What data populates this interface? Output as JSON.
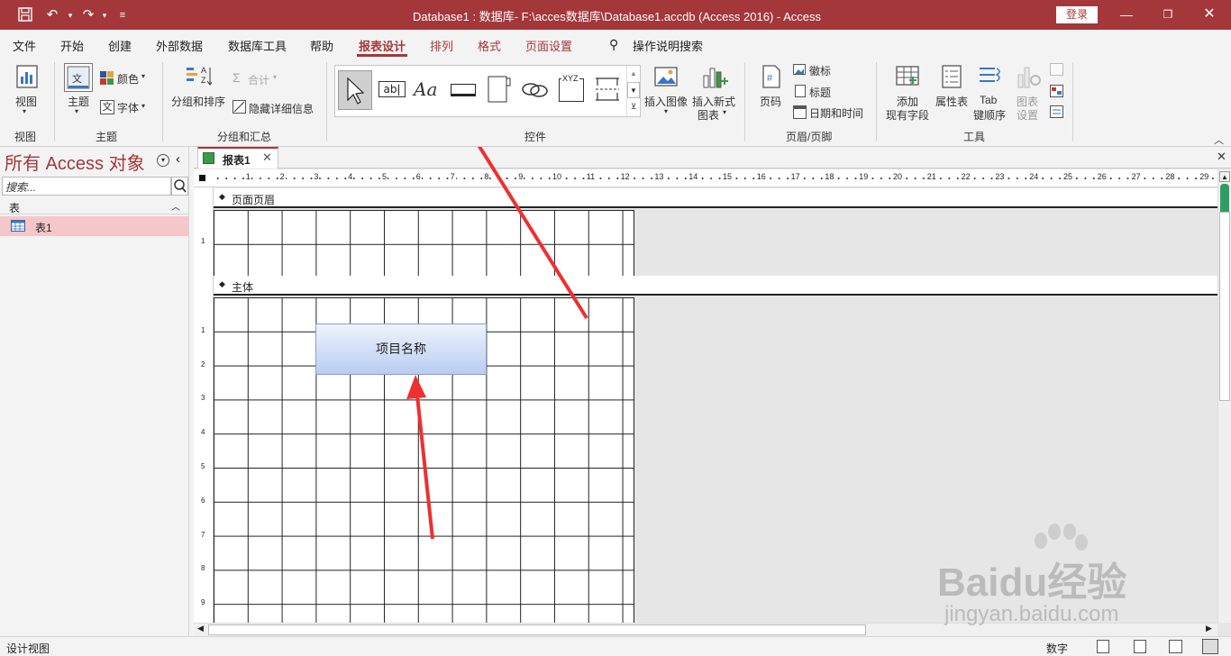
{
  "titlebar": {
    "title": "Database1 : 数据库- F:\\acces数据库\\Database1.accdb (Access 2016)  -  Access",
    "login": "登录",
    "colors": {
      "accent": "#a4373a"
    }
  },
  "menu_tabs": [
    "文件",
    "开始",
    "创建",
    "外部数据",
    "数据库工具",
    "帮助",
    "报表设计",
    "排列",
    "格式",
    "页面设置"
  ],
  "active_tab": "报表设计",
  "tell_me": "操作说明搜索",
  "ribbon": {
    "views": {
      "view": "视图",
      "group": "视图"
    },
    "themes": {
      "theme": "主题",
      "colors": "颜色",
      "fonts": "字体",
      "group": "主题"
    },
    "grouping": {
      "group_sort": "分组和排序",
      "totals": "合计",
      "hide_details": "隐藏详细信息",
      "group": "分组和汇总"
    },
    "controls": {
      "group": "控件",
      "insert_image": "插入图像",
      "insert_chart_1": "插入新式",
      "insert_chart_2": "图表",
      "textbox_glyph": "ab|",
      "label_glyph": "Aa",
      "xyz_glyph": "XYZ"
    },
    "header_footer": {
      "page_numbers": "页码",
      "logo": "徽标",
      "title": "标题",
      "date_time": "日期和时间",
      "group": "页眉/页脚"
    },
    "tools": {
      "add_fields_1": "添加",
      "add_fields_2": "现有字段",
      "property_sheet": "属性表",
      "tab_order_1": "Tab",
      "tab_order_2": "键顺序",
      "chart_settings_1": "图表",
      "chart_settings_2": "设置",
      "group": "工具"
    }
  },
  "nav_pane": {
    "title": "所有 Access 对象",
    "search_placeholder": "搜索...",
    "group": "表",
    "items": [
      {
        "label": "表1"
      }
    ]
  },
  "document": {
    "tab_label": "报表1",
    "ruler_marks": [
      "1",
      "2",
      "3",
      "4",
      "5",
      "6",
      "7",
      "8",
      "9",
      "10",
      "11",
      "12",
      "13",
      "14",
      "15",
      "16",
      "17",
      "18",
      "19",
      "20",
      "21",
      "22",
      "23",
      "24",
      "25",
      "26",
      "27",
      "28",
      "29"
    ],
    "vruler_marks": [
      "1",
      "2",
      "3",
      "4",
      "5",
      "6",
      "7",
      "8",
      "9"
    ],
    "sections": {
      "page_header": "页面页眉",
      "detail": "主体"
    },
    "label_control": "项目名称"
  },
  "statusbar": {
    "left": "设计视图",
    "num": "数字"
  },
  "watermark": {
    "brand": "Baidu经验",
    "url": "jingyan.baidu.com"
  }
}
